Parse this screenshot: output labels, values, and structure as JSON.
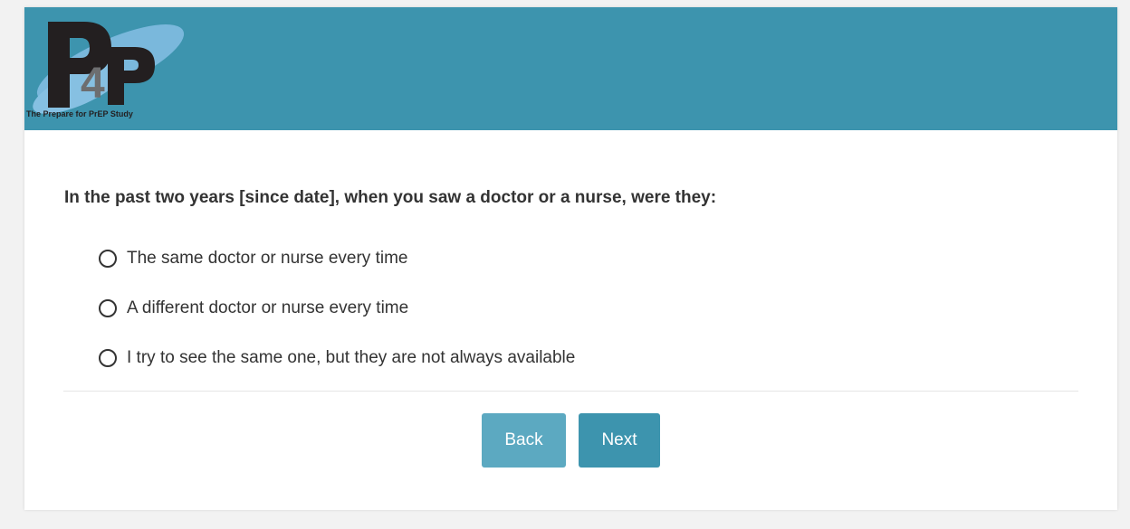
{
  "header": {
    "logo_text": "P4P",
    "logo_caption": "The Prepare for PrEP Study",
    "background_color": "#3d94ae"
  },
  "question": {
    "text": "In the past two years [since date], when you saw a doctor or a nurse, were they:",
    "options": [
      {
        "label": "The same doctor or nurse every time",
        "selected": false
      },
      {
        "label": "A different doctor or nurse every time",
        "selected": false
      },
      {
        "label": "I try to see the same one, but they are not always available",
        "selected": false
      }
    ]
  },
  "navigation": {
    "back_label": "Back",
    "next_label": "Next",
    "back_color": "#5ca9c1",
    "next_color": "#3d94ae"
  }
}
